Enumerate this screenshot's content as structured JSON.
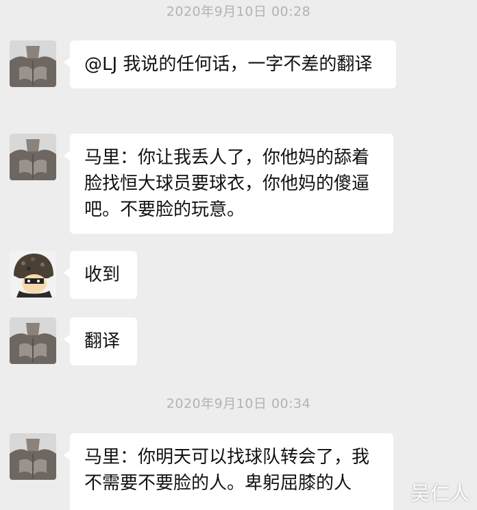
{
  "timestamps": [
    "2020年9月10日 00:28",
    "2020年9月10日 00:34"
  ],
  "messages": [
    {
      "sender_avatar": "marble-torso-avatar",
      "text": "@LJ 我说的任何话，一字不差的翻译"
    },
    {
      "sender_avatar": "marble-torso-avatar",
      "text": "马里：你让我丢人了，你他妈的舔着脸找恒大球员要球衣，你他妈的傻逼吧。不要脸的玩意。"
    },
    {
      "sender_avatar": "helmet-cartoon-avatar",
      "text": "收到"
    },
    {
      "sender_avatar": "marble-torso-avatar",
      "text": "翻译"
    },
    {
      "sender_avatar": "marble-torso-avatar",
      "text": "马里：你明天可以找球队转会了，我不需要不要脸的人。卑躬屈膝的人"
    }
  ],
  "watermark": "吴仁人",
  "colors": {
    "background": "#ededed",
    "bubble": "#ffffff",
    "timestamp_text": "#b2b2b2",
    "message_text": "#111111"
  }
}
